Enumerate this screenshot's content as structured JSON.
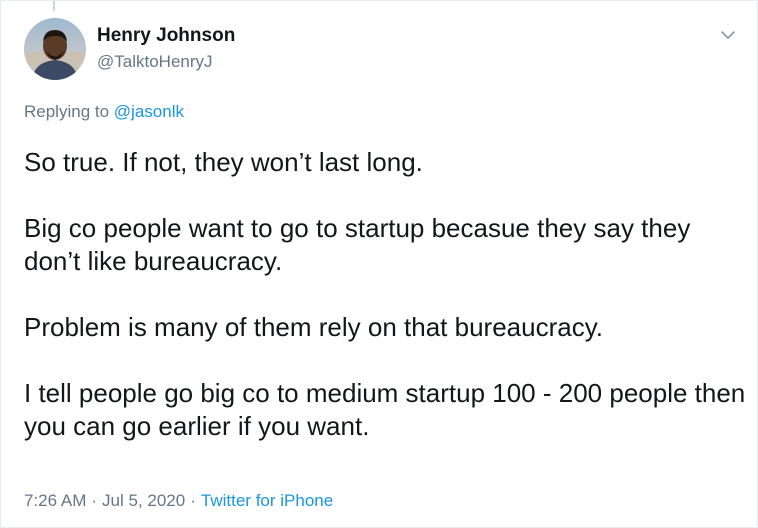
{
  "author": {
    "name": "Henry Johnson",
    "handle": "@TalktoHenryJ"
  },
  "reply": {
    "prefix": "Replying to",
    "mention": "@jasonlk"
  },
  "tweet": {
    "paragraphs": [
      "So true. If not, they won’t last long.",
      "Big co people want to go to startup becasue they say they don’t like bureaucracy.",
      "Problem is many of them rely on that bureaucracy.",
      "I tell people go big co to medium startup 100 - 200 people then you can go earlier if you want."
    ]
  },
  "meta": {
    "time": "7:26 AM",
    "separator": "·",
    "date": "Jul 5, 2020",
    "source": "Twitter for iPhone"
  },
  "colors": {
    "text": "#14171a",
    "secondary": "#657786",
    "link": "#1b95e0",
    "border": "#e6ecf0"
  },
  "icons": {
    "menu": "chevron-down-icon",
    "avatar": "profile-photo"
  }
}
